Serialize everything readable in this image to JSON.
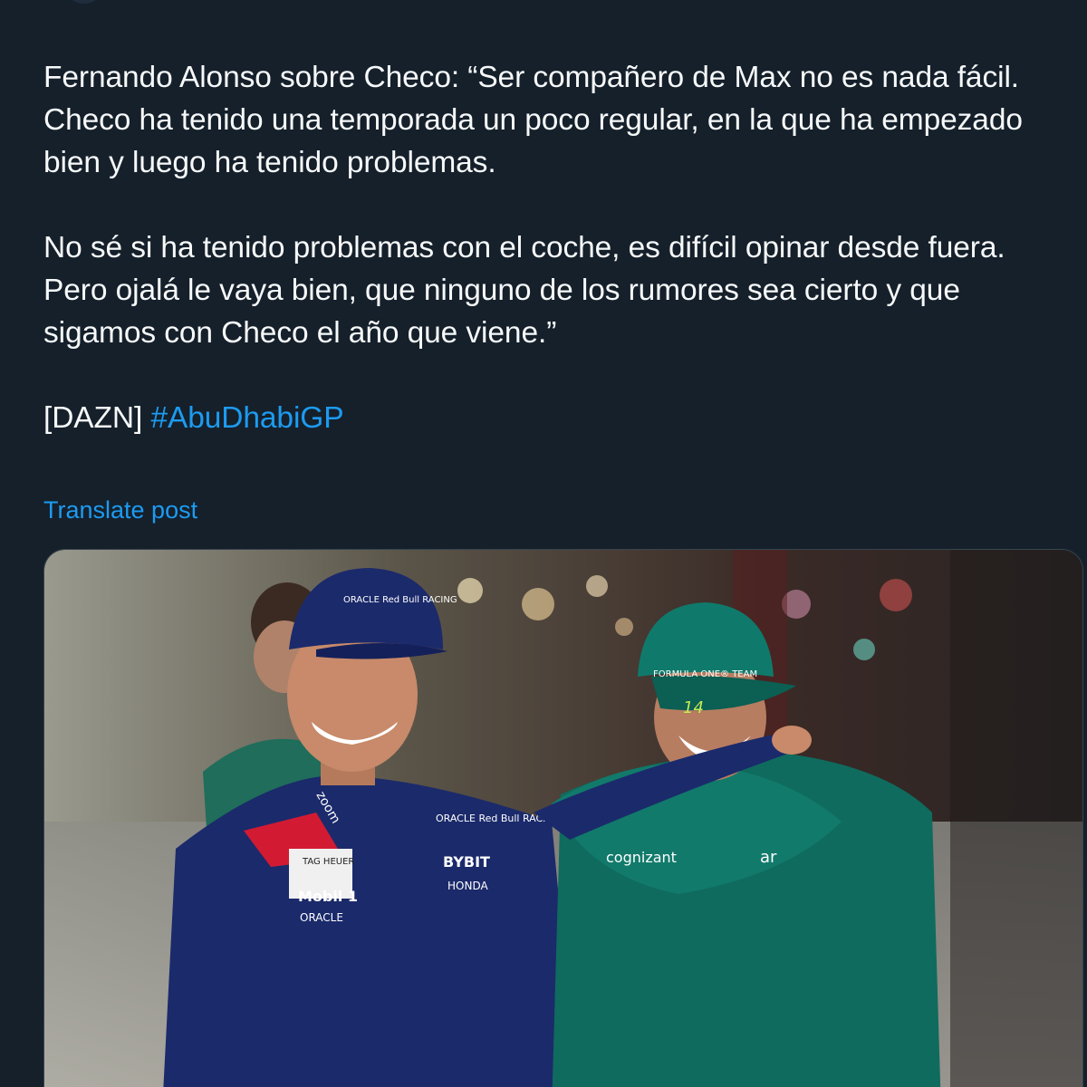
{
  "tweet": {
    "paragraph_1": "Fernando Alonso sobre Checo: “Ser compañero de Max no es nada fácil. Checo ha tenido una temporada un poco regular, en la que ha empezado bien y luego ha tenido problemas.",
    "paragraph_2": "No sé si ha tenido problemas con el coche, es difícil opinar desde fuera. Pero ojalá le vaya bien, que ninguno de los rumores sea cierto y que sigamos con Checo el año que viene.”",
    "source_tag": "[DAZN]",
    "hashtag": "#AbuDhabiGP"
  },
  "actions": {
    "translate_label": "Translate post"
  },
  "photo": {
    "left_cap_text": "ORACLE Red Bull RACING",
    "zoom_text": "zoom",
    "tag_text": "TAG HEUER",
    "mobil_text": "Mobil 1",
    "oracle_text": "ORACLE",
    "oracle_chest_text": "ORACLE Red Bull RACING",
    "bybit_text": "BYBIT",
    "honda_text": "HONDA",
    "right_cap_text": "FORMULA ONE® TEAM",
    "number_text": "14",
    "cognizant_text": "cognizant",
    "sleeve_text": "ar"
  },
  "colors": {
    "background": "#15202b",
    "text": "#f7f9f9",
    "link": "#1d9bf0",
    "redbull_navy": "#1b2a6b",
    "astonmartin_green": "#0f6b5e"
  }
}
